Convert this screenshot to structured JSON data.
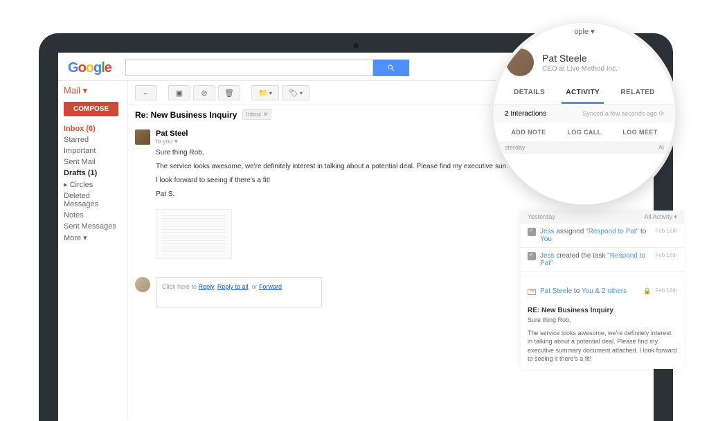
{
  "header": {
    "logo": {
      "g1": "G",
      "o1": "o",
      "o2": "o",
      "g2": "g",
      "l": "l",
      "e": "e"
    },
    "search_placeholder": ""
  },
  "sidebar": {
    "mail_label": "Mail ▾",
    "compose_label": "COMPOSE",
    "folders": [
      {
        "label": "Inbox (6)",
        "active": true
      },
      {
        "label": "Starred"
      },
      {
        "label": "Important"
      },
      {
        "label": "Sent Mail"
      },
      {
        "label": "Drafts (1)",
        "bold": true
      },
      {
        "label": "▸ Circles"
      },
      {
        "label": "Deleted Messages"
      },
      {
        "label": "Notes"
      },
      {
        "label": "Sent Messages"
      },
      {
        "label": "More ▾"
      }
    ]
  },
  "email": {
    "subject": "Re: New Business Inquiry",
    "inbox_tag": "Inbox  ✕",
    "sender_name": "Pat Steel",
    "to_line": "to you ▾",
    "body_line1": "Sure thing Rob,",
    "body_line2": "The service looks awesome, we're definitely interest in talking about a potential deal. Please find my executive summary document attached.",
    "body_line3": "I look forward to seeing if there's a fit!",
    "signoff": "Pat S.",
    "reply_prefix": "Click here to ",
    "reply_link1": "Reply",
    "reply_sep1": ", ",
    "reply_link2": "Reply to all",
    "reply_sep2": ", or ",
    "reply_link3": "Forward"
  },
  "crm": {
    "section1_left": "Yesterday",
    "section1_right": "All Activity ▾",
    "activity1": {
      "user": "Jess",
      "action": " assigned ",
      "quoted": "\"Respond to Pat\"",
      "suffix": " to ",
      "target": "You",
      "date": "Feb 16th"
    },
    "activity2": {
      "user": "Jess",
      "action": " created the task ",
      "quoted": "\"Respond to Pat\"",
      "date": "Feb 16th"
    },
    "activity3": {
      "from": "Pat Steele",
      "to_prefix": " to ",
      "to": "You & 2 others",
      "date": "Feb 16th",
      "subject": "RE: New Business Inquiry",
      "line1": "Sure thing Rob,",
      "preview": "The service looks awesome, we're definitely interest in talking about a potential deal. Please find my executive summary document attached. I look forward to seeing it there's a fit!"
    }
  },
  "magnifier": {
    "people_dropdown": "ople ▾",
    "profile_name": "Pat Steele",
    "profile_role": "CEO at Live Method Inc.",
    "tabs": {
      "details": "DETAILS",
      "activity": "ACTIVITY",
      "related": "RELATED"
    },
    "interactions_count": "2",
    "interactions_label": " Interactions",
    "synced": "Synced a few seconds ago  ⟳",
    "actions": {
      "note": "ADD NOTE",
      "call": "LOG CALL",
      "meeting": "LOG MEET"
    },
    "sect_left": "sterday",
    "sect_right": "Al"
  }
}
